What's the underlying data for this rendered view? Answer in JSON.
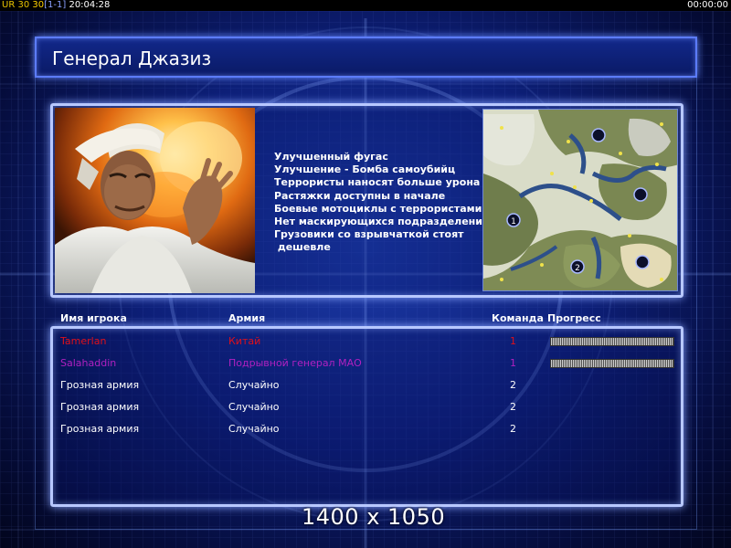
{
  "hud": {
    "ur_label": "UR",
    "value_1": "30",
    "value_2": "30",
    "bracket_value": "[1-1]",
    "clock": "20:04:28",
    "timer": "00:00:00"
  },
  "general": {
    "title": "Генерал Джазиз",
    "perks": [
      "Улучшенный фугас",
      "Улучшение - Бомба самоубийц",
      "Террористы наносят больше урона",
      "Растяжки доступны в начале",
      "Боевые мотоциклы с террористами",
      "Нет маскирующихся подразделений",
      "Грузовики со взрывчаткой стоят",
      " дешевле"
    ]
  },
  "minimap": {
    "start_positions": [
      "1",
      "2"
    ]
  },
  "table": {
    "headers": {
      "player_name": "Имя игрока",
      "army": "Армия",
      "team": "Команда",
      "progress": "Прогресс"
    },
    "rows": [
      {
        "name": "Tamerlan",
        "army": "Китай",
        "team": "1",
        "color": "#e0101a",
        "progress": 1.0
      },
      {
        "name": "Salahaddin",
        "army": "Подрывной генерал МАО",
        "team": "1",
        "color": "#b020c0",
        "progress": 1.0
      },
      {
        "name": "Грозная армия",
        "army": "Случайно",
        "team": "2",
        "color": "#ffffff"
      },
      {
        "name": "Грозная армия",
        "army": "Случайно",
        "team": "2",
        "color": "#ffffff"
      },
      {
        "name": "Грозная армия",
        "army": "Случайно",
        "team": "2",
        "color": "#ffffff"
      }
    ]
  },
  "resolution_label": "1400 x 1050"
}
